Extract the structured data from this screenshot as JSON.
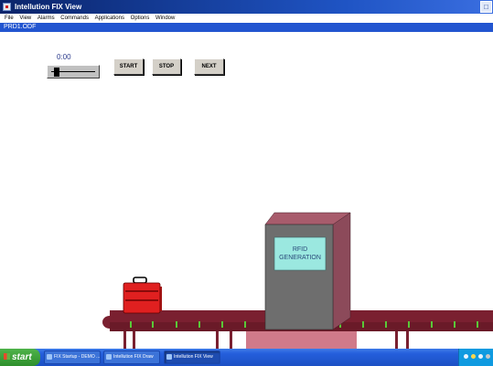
{
  "window": {
    "title": "Intellution FIX View"
  },
  "menu": {
    "items": [
      "File",
      "View",
      "Alarms",
      "Commands",
      "Applications",
      "Options",
      "Window"
    ]
  },
  "document": {
    "tab": "PRD1.ODF"
  },
  "controls": {
    "counter": "0:00",
    "slider_level": 0.05,
    "start_label": "START",
    "stop_label": "STOP",
    "next_label": "NEXT"
  },
  "scene": {
    "station_label_line1": "RFID",
    "station_label_line2": "GENERATION",
    "colors": {
      "conveyor": "#7a2030",
      "station_front": "#6e6e6e",
      "station_side": "#8c4a5a",
      "station_top": "#a85c6c",
      "display": "#9be8e0",
      "luggage": "#e02020",
      "belt_marker": "#5ac838"
    }
  },
  "taskbar": {
    "start_label": "start",
    "tasks": [
      "FIX Startup - DEMO ...",
      "Intellution FIX Draw",
      "Intellution FIX View"
    ]
  }
}
